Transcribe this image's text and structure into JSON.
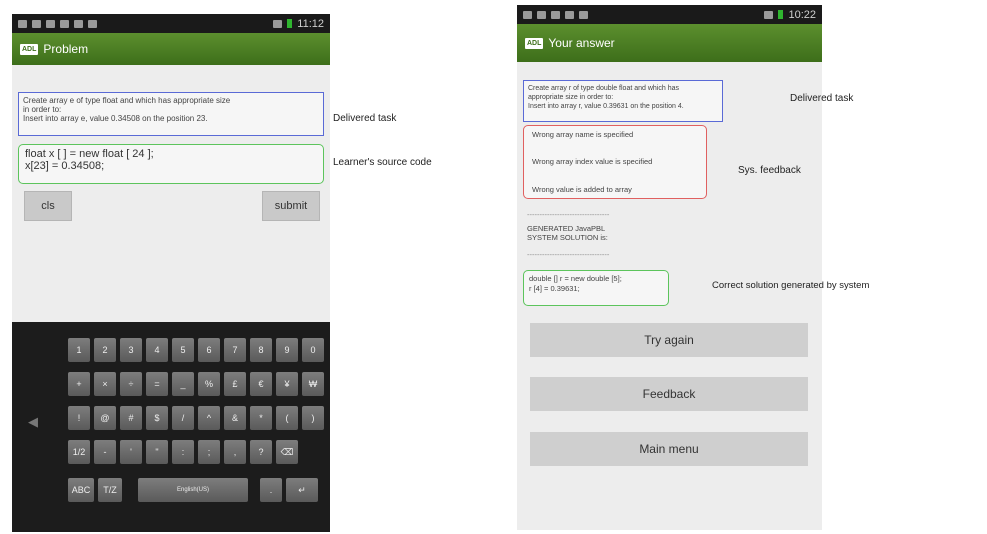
{
  "left_screen": {
    "status": {
      "time": "11:12"
    },
    "app": {
      "logo": "ADL",
      "title": "Problem"
    },
    "task": {
      "lines": [
        "Create array e of type float and which has appropriate size",
        "in order to:",
        "Insert into array e, value 0.34508 on the position 23."
      ]
    },
    "code": {
      "lines": [
        "float x [ ] = new float [ 24 ];",
        "x[23] = 0.34508;"
      ]
    },
    "buttons": {
      "cls": "cls",
      "submit": "submit"
    },
    "keyboard": {
      "row1": [
        "1",
        "2",
        "3",
        "4",
        "5",
        "6",
        "7",
        "8",
        "9",
        "0"
      ],
      "row2": [
        "+",
        "×",
        "÷",
        "=",
        "_",
        "%",
        "£",
        "€",
        "¥",
        "₩"
      ],
      "row3": [
        "!",
        "@",
        "#",
        "$",
        "/",
        "^",
        "&",
        "*",
        "(",
        ")"
      ],
      "row4": [
        "1/2",
        "-",
        "'",
        "\"",
        ":",
        ";",
        ",",
        "?",
        "⌫"
      ],
      "row5": {
        "abc": "ABC",
        "tz": "T/Z",
        "space": "English(US)",
        "dot": ".",
        "enter": "↵"
      },
      "left_chevron": "◀"
    }
  },
  "right_screen": {
    "status": {
      "time": "10:22"
    },
    "app": {
      "logo": "ADL",
      "title": "Your answer"
    },
    "task": {
      "lines": [
        "Create array r of type double float and which has",
        "appropriate size in order to:",
        "Insert into array r, value 0.39631 on the position 4."
      ]
    },
    "feedback": {
      "lines": [
        "Wrong array name is specified",
        "Wrong array index value is specified",
        "Wrong value is added to array"
      ]
    },
    "separator": "---------------------------------",
    "generated": {
      "lines": [
        "GENERATED JavaPBL",
        "SYSTEM SOLUTION is:"
      ]
    },
    "solution": {
      "lines": [
        "double [] r = new double [5];",
        "r [4] = 0.39631;"
      ]
    },
    "buttons": {
      "try_again": "Try again",
      "feedback": "Feedback",
      "main_menu": "Main menu"
    }
  },
  "annotations": {
    "delivered_left": "Delivered task",
    "source_code": "Learner's source code",
    "delivered_right": "Delivered task",
    "sys_feedback": "Sys. feedback",
    "correct_solution": "Correct solution generated by system"
  },
  "colors": {
    "task_border": "#5a6ad6",
    "code_border": "#5cc45c",
    "feedback_border": "#e06060",
    "actionbar": "#4a7d22"
  }
}
